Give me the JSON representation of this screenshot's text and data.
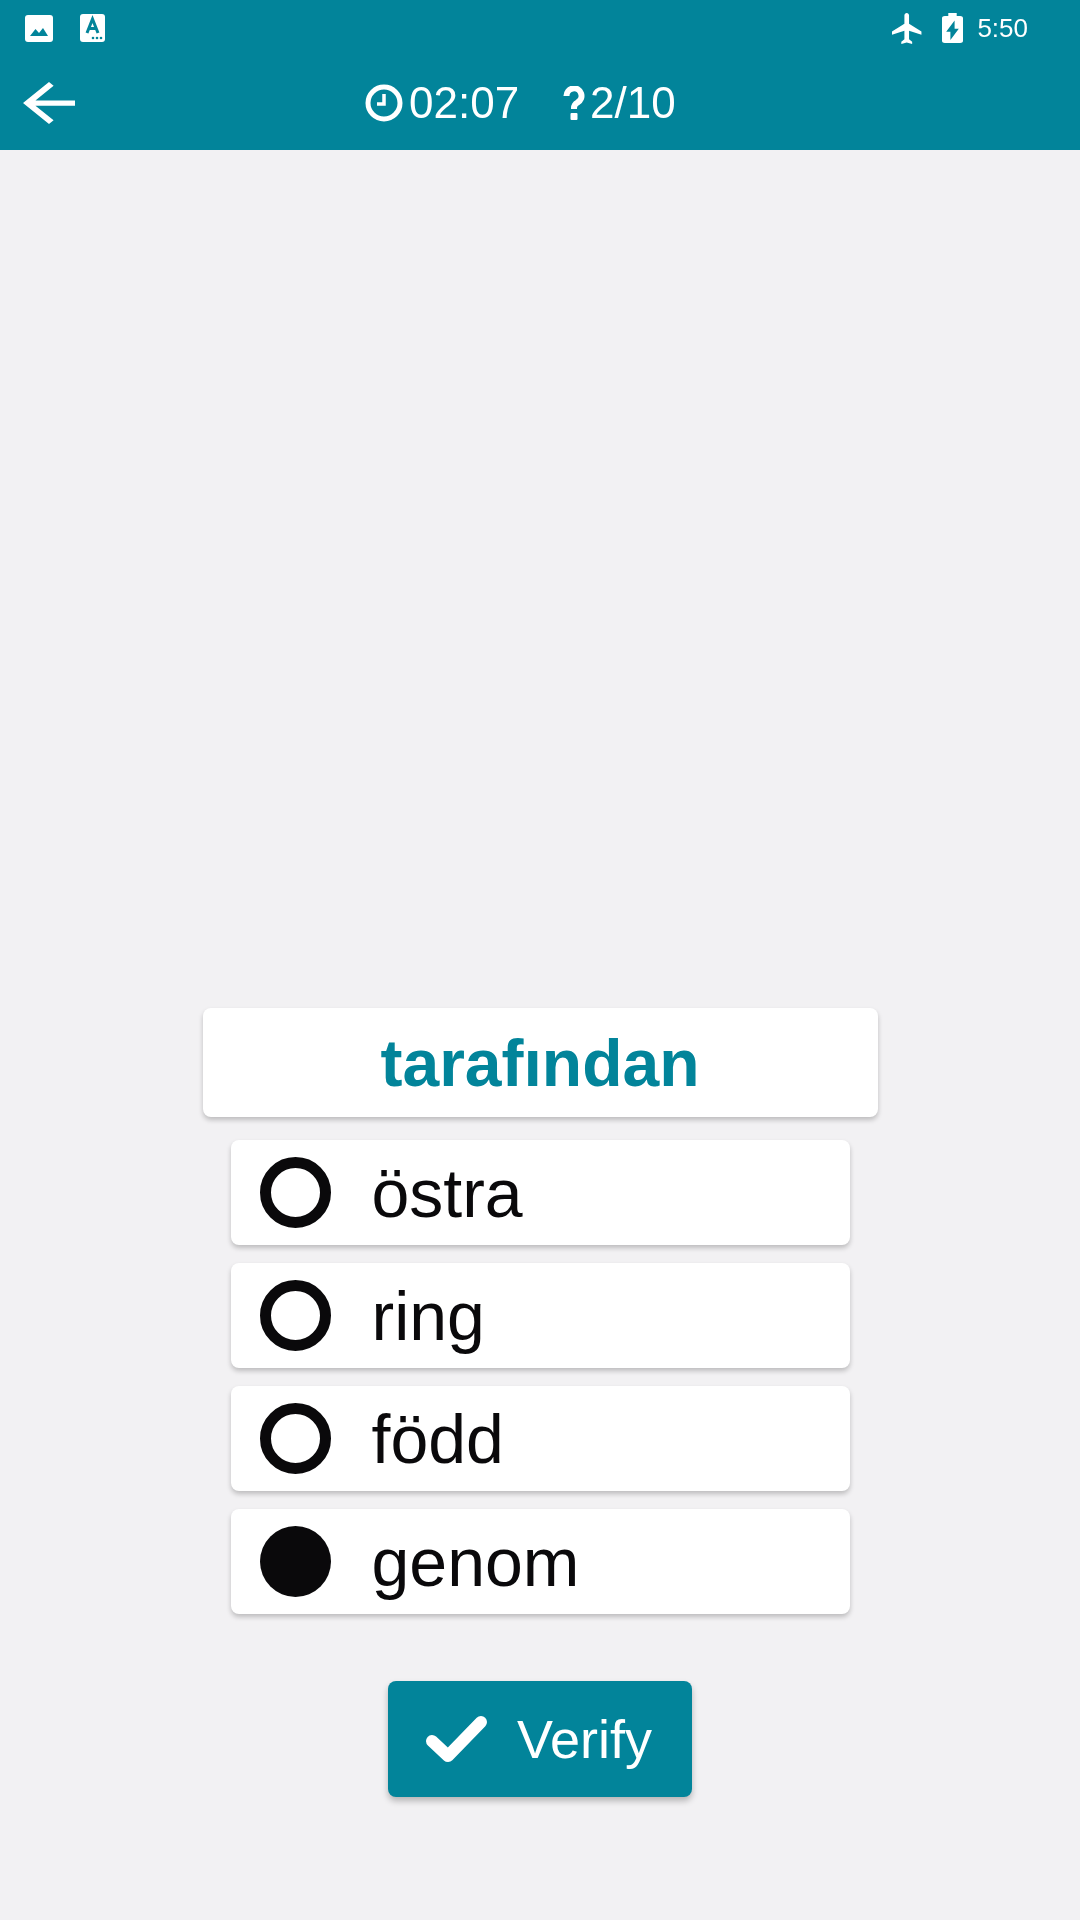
{
  "status_bar": {
    "time": "5:50"
  },
  "toolbar": {
    "timer": "02:07",
    "question_counter": "2/10"
  },
  "word": "tarafından",
  "options": [
    {
      "label": "östra",
      "selected": false
    },
    {
      "label": "ring",
      "selected": false
    },
    {
      "label": "född",
      "selected": false
    },
    {
      "label": "genom",
      "selected": true
    }
  ],
  "verify_button": {
    "label": "Verify"
  }
}
